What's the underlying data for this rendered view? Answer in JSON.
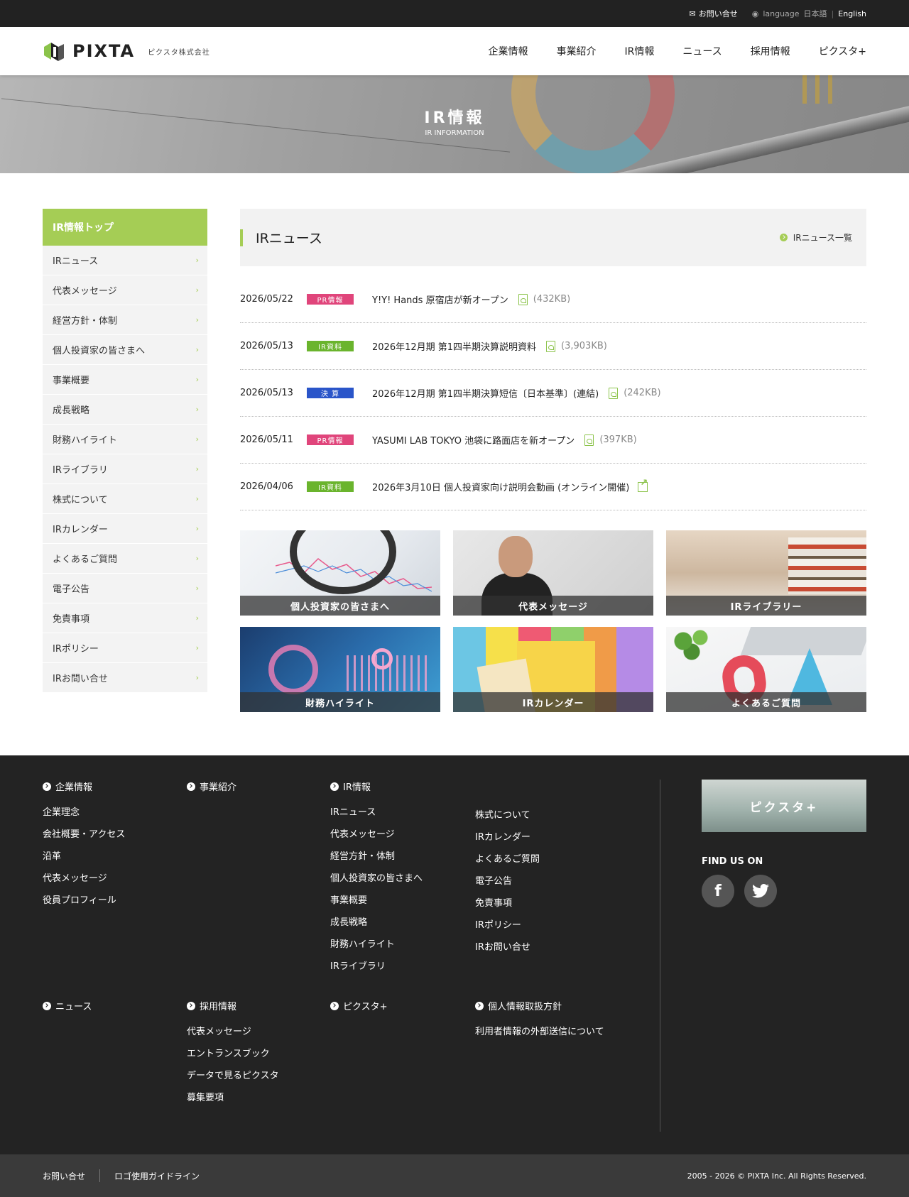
{
  "topbar": {
    "contact": "お問い合せ",
    "language_label": "language",
    "lang_ja": "日本語",
    "lang_sep": "|",
    "lang_en": "English"
  },
  "header": {
    "logo_word": "PIXTA",
    "logo_sub": "ピクスタ株式会社",
    "nav": [
      "企業情報",
      "事業紹介",
      "IR情報",
      "ニュース",
      "採用情報",
      "ピクスタ+"
    ]
  },
  "hero": {
    "title": "IR情報",
    "subtitle": "IR INFORMATION"
  },
  "sidebar": {
    "head": "IR情報トップ",
    "items": [
      "IRニュース",
      "代表メッセージ",
      "経営方針・体制",
      "個人投資家の皆さまへ",
      "事業概要",
      "成長戦略",
      "財務ハイライト",
      "IRライブラリ",
      "株式について",
      "IRカレンダー",
      "よくあるご質問",
      "電子公告",
      "免責事項",
      "IRポリシー",
      "IRお問い合せ"
    ],
    "chevron": "›"
  },
  "news": {
    "title": "IRニュース",
    "more": "IRニュース一覧",
    "items": [
      {
        "date": "2026/05/22",
        "badge": "PR情報",
        "badge_color": "#e0457b",
        "title": "Y!Y! Hands 原宿店が新オープン",
        "size": "(432KB)",
        "icon": "pdf-icon"
      },
      {
        "date": "2026/05/13",
        "badge": "IR資料",
        "badge_color": "#6ab42d",
        "title": "2026年12月期 第1四半期決算説明資料",
        "size": "(3,903KB)",
        "icon": "pdf-icon"
      },
      {
        "date": "2026/05/13",
        "badge": "決 算",
        "badge_color": "#2a55c9",
        "title": "2026年12月期 第1四半期決算短信〔日本基準〕(連結)",
        "size": "(242KB)",
        "icon": "pdf-icon"
      },
      {
        "date": "2026/05/11",
        "badge": "PR情報",
        "badge_color": "#e0457b",
        "title": "YASUMI LAB TOKYO 池袋に路面店を新オープン",
        "size": "(397KB)",
        "icon": "pdf-icon"
      },
      {
        "date": "2026/04/06",
        "badge": "IR資料",
        "badge_color": "#6ab42d",
        "title": "2026年3月10日 個人投資家向け説明会動画 (オンライン開催)",
        "size": "",
        "icon": "external-link-icon"
      }
    ]
  },
  "tiles": [
    "個人投資家の皆さまへ",
    "代表メッセージ",
    "IRライブラリー",
    "財務ハイライト",
    "IRカレンダー",
    "よくあるご質問"
  ],
  "footer": {
    "col1": {
      "head": "企業情報",
      "links": [
        "企業理念",
        "会社概要・アクセス",
        "沿革",
        "代表メッセージ",
        "役員プロフィール"
      ]
    },
    "col2": {
      "head": "事業紹介",
      "links": []
    },
    "col3": {
      "head": "IR情報",
      "links": [
        "IRニュース",
        "代表メッセージ",
        "経営方針・体制",
        "個人投資家の皆さまへ",
        "事業概要",
        "成長戦略",
        "財務ハイライト",
        "IRライブラリ"
      ]
    },
    "col3b": {
      "links": [
        "株式について",
        "IRカレンダー",
        "よくあるご質問",
        "電子公告",
        "免責事項",
        "IRポリシー",
        "IRお問い合せ"
      ]
    },
    "col4": {
      "head": "ニュース",
      "links": []
    },
    "col5": {
      "head": "採用情報",
      "links": [
        "代表メッセージ",
        "エントランスブック",
        "データで見るピクスタ",
        "募集要項"
      ]
    },
    "col6": {
      "head": "ピクスタ+",
      "links": []
    },
    "col7": {
      "head": "個人情報取扱方針",
      "links": [
        "利用者情報の外部送信について"
      ]
    },
    "banner": "ピクスタ+",
    "findus": "FIND US ON",
    "facebook": "f",
    "twitter": "t"
  },
  "bottombar": {
    "contact": "お問い合せ",
    "logo_guide": "ロゴ使用ガイドライン",
    "copyright": "2005 - 2026 © PIXTA Inc. All Rights Reserved."
  },
  "colors": {
    "accent": "#a5cd55",
    "dark": "#232323"
  }
}
